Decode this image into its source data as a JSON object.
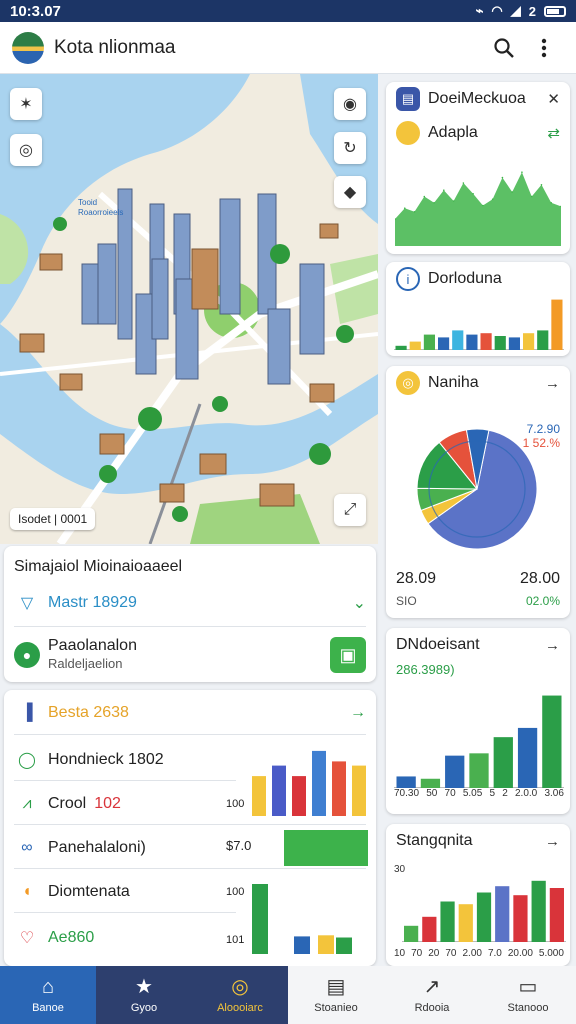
{
  "status": {
    "time": "10:3.07",
    "battery": "2"
  },
  "app": {
    "title": "Kota nlionmaa"
  },
  "map": {
    "tag_line1": "Tooid",
    "tag_line2": "Roaorroieels",
    "scale_label": "Isodet | 0001"
  },
  "right_cards": {
    "card1": {
      "title": "DoeiMeckuoa",
      "sub_title": "Adapla"
    },
    "card2": {
      "title": "Dorloduna"
    },
    "card3": {
      "title": "Naniha",
      "legend_top": "7.2.90",
      "legend_sub": "1 52.%",
      "foot_left_value": "28.09",
      "foot_left_sub": "SIO",
      "foot_right_value": "28.00",
      "foot_right_sub": "02.0%"
    },
    "card4": {
      "title": "DNdoeisant",
      "subtitle": "286.3989)",
      "x_labels": [
        "70.30",
        "50",
        "70",
        "5.05",
        "5",
        "2",
        "2.0.0",
        "3.06"
      ]
    },
    "card5": {
      "title": "Stangqnita",
      "y_label": "30",
      "x_labels": [
        "10",
        "70",
        "20",
        "70",
        "2.00",
        "7.0",
        "20.00",
        "5.000"
      ]
    }
  },
  "panel1": {
    "title": "Simajaiol Mioinaioaaeel",
    "select_value": "Mastr 18929",
    "item_title": "Paaolanalon",
    "item_sub": "Raldeljaelion"
  },
  "panel2": {
    "header": "Besta 2638",
    "rows": [
      {
        "label": "Hondnieck 1802"
      },
      {
        "label": "Crool",
        "extra": "102"
      },
      {
        "label": "Panehalaloni)",
        "value": "$7.0"
      },
      {
        "label": "Diomtenata",
        "value": "100"
      },
      {
        "label": "Ae860",
        "value": "101"
      }
    ],
    "tick_100": "100"
  },
  "nav": [
    {
      "label": "Banoe",
      "icon": "home-icon"
    },
    {
      "label": "Gyoo",
      "icon": "star-icon"
    },
    {
      "label": "Aloooiarc",
      "icon": "compass-icon"
    },
    {
      "label": "Stoanieo",
      "icon": "document-icon"
    },
    {
      "label": "Rdooia",
      "icon": "chart-icon"
    },
    {
      "label": "Stanooo",
      "icon": "panel-icon"
    }
  ],
  "chart_data": [
    {
      "type": "area",
      "values": [
        30,
        42,
        38,
        55,
        48,
        62,
        50,
        70,
        58,
        45,
        52,
        76,
        60,
        82,
        55,
        68,
        48,
        44
      ],
      "color": "#3fb54a",
      "ylim": [
        0,
        100
      ]
    },
    {
      "type": "bar",
      "values": [
        6,
        12,
        22,
        18,
        28,
        22,
        24,
        20,
        18,
        24,
        28,
        72
      ],
      "colors": [
        "#2b9e48",
        "#f3c43b",
        "#4ab04f",
        "#2a66b5",
        "#3db4e0",
        "#2a66b5",
        "#e5523b",
        "#2b9e48",
        "#2a66b5",
        "#f3c43b",
        "#2b9e48",
        "#f39a25"
      ],
      "ylim": [
        0,
        80
      ]
    },
    {
      "type": "pie",
      "values": [
        62,
        4,
        6,
        14,
        8,
        6
      ],
      "colors": [
        "#5b73c7",
        "#f3c43b",
        "#4ab04f",
        "#2b9e48",
        "#e5523b",
        "#2a66b5"
      ]
    },
    {
      "type": "bar",
      "values": [
        10,
        8,
        28,
        30,
        44,
        52,
        80
      ],
      "colors": [
        "#2a66b5",
        "#4ab04f",
        "#2a66b5",
        "#4ab04f",
        "#2b9e48",
        "#2a66b5",
        "#2b9e48"
      ],
      "ylim": [
        0,
        90
      ]
    },
    {
      "type": "bar",
      "values": [
        18,
        28,
        45,
        42,
        55,
        62,
        52,
        68,
        60
      ],
      "colors": [
        "#4ab04f",
        "#d9343a",
        "#2b9e48",
        "#f3c43b",
        "#2b9e48",
        "#5b73c7",
        "#d9343a",
        "#2b9e48",
        "#d9343a"
      ],
      "ylim": [
        0,
        80
      ]
    },
    {
      "type": "bar",
      "values": [
        38,
        48,
        38,
        62,
        52,
        48,
        42,
        64,
        68,
        60
      ],
      "colors": [
        "#f3c43b",
        "#4a5bc7",
        "#d9343a",
        "#3f7fd1",
        "#e5523b",
        "#f3c43b",
        "#2b9e48",
        "#2a66b5",
        "#f3c43b",
        "#2b9e48"
      ],
      "ylim": [
        0,
        80
      ]
    }
  ]
}
